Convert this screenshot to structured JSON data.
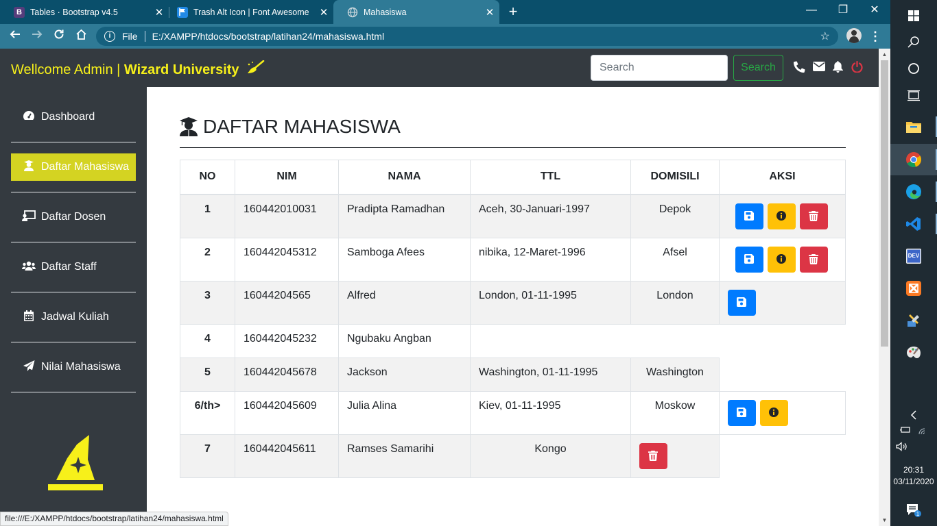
{
  "browser": {
    "tabs": [
      {
        "title": "Tables · Bootstrap v4.5",
        "favicon": "bootstrap-icon",
        "favicon_letter": "B",
        "favicon_color": "#563d7c",
        "active": false
      },
      {
        "title": "Trash Alt Icon | Font Awesome",
        "favicon": "flag-icon",
        "favicon_color": "#228ae6",
        "active": false
      },
      {
        "title": "Mahasiswa",
        "favicon": "globe-icon",
        "active": true
      }
    ],
    "address": {
      "scheme_label": "File",
      "url": "E:/XAMPP/htdocs/bootstrap/latihan24/mahasiswa.html"
    },
    "status_url": "file:///E:/XAMPP/htdocs/bootstrap/latihan24/mahasiswa.html"
  },
  "navbar": {
    "welcome": "Wellcome Admin | ",
    "university": "Wizard University",
    "search_placeholder": "Search",
    "search_button": "Search",
    "icons": [
      "phone-icon",
      "envelope-icon",
      "bell-icon",
      "power-icon"
    ],
    "brand_color": "#f7f01a"
  },
  "sidebar": {
    "items": [
      {
        "label": "Dashboard",
        "icon": "tachometer-icon",
        "active": false
      },
      {
        "label": "Daftar Mahasiswa",
        "icon": "user-graduate-icon",
        "active": true
      },
      {
        "label": "Daftar Dosen",
        "icon": "chalkboard-teacher-icon",
        "active": false
      },
      {
        "label": "Daftar Staff",
        "icon": "users-icon",
        "active": false
      },
      {
        "label": "Jadwal Kuliah",
        "icon": "calendar-icon",
        "active": false
      },
      {
        "label": "Nilai Mahasiswa",
        "icon": "paper-plane-icon",
        "active": false
      }
    ],
    "active_color": "#d4d322"
  },
  "main": {
    "title": "DAFTAR MAHASISWA",
    "table": {
      "headers": [
        "NO",
        "NIM",
        "NAMA",
        "TTL",
        "DOMISILI",
        "AKSI"
      ],
      "rows": [
        {
          "no": "1",
          "nim": "160442010031",
          "nama": "Pradipta Ramadhan",
          "ttl": "Aceh, 30-Januari-1997",
          "domisili": "Depok",
          "aksi": [
            "save",
            "info",
            "delete"
          ]
        },
        {
          "no": "2",
          "nim": "160442045312",
          "nama": "Samboga Afees",
          "ttl": "nibika, 12-Maret-1996",
          "domisili": "Afsel",
          "aksi": [
            "save",
            "info",
            "delete"
          ]
        },
        {
          "no": "3",
          "nim": "16044204565",
          "nama": "Alfred",
          "ttl": "London, 01-11-1995",
          "domisili": "London",
          "aksi": [
            "save"
          ]
        },
        {
          "no": "4",
          "nim": "160442045232",
          "nama": "Ngubaku Angban"
        },
        {
          "no": "5",
          "nim": "160442045678",
          "nama": "Jackson",
          "ttl": "Washington, 01-11-1995",
          "domisili": "Washington"
        },
        {
          "no": "6/th>",
          "nim": "160442045609",
          "nama": "Julia Alina",
          "ttl": "Kiev, 01-11-1995",
          "domisili": "Moskow",
          "aksi": [
            "save",
            "info"
          ]
        },
        {
          "no": "7",
          "nim": "160442045611",
          "nama": "Ramses Samarihi",
          "ttl": "Kongo",
          "aksi": [
            "delete"
          ]
        }
      ]
    },
    "button_colors": {
      "save": "#007bff",
      "info": "#ffc107",
      "delete": "#dc3545"
    }
  },
  "taskbar": {
    "apps": [
      "windows-start-icon",
      "search-icon",
      "cortana-icon",
      "task-view-icon",
      "file-explorer-icon",
      "chrome-icon",
      "edge-icon",
      "vscode-icon",
      "dev-icon",
      "xampp-icon",
      "tools-icon",
      "paint-icon"
    ],
    "time": "20:31",
    "date": "03/11/2020"
  }
}
